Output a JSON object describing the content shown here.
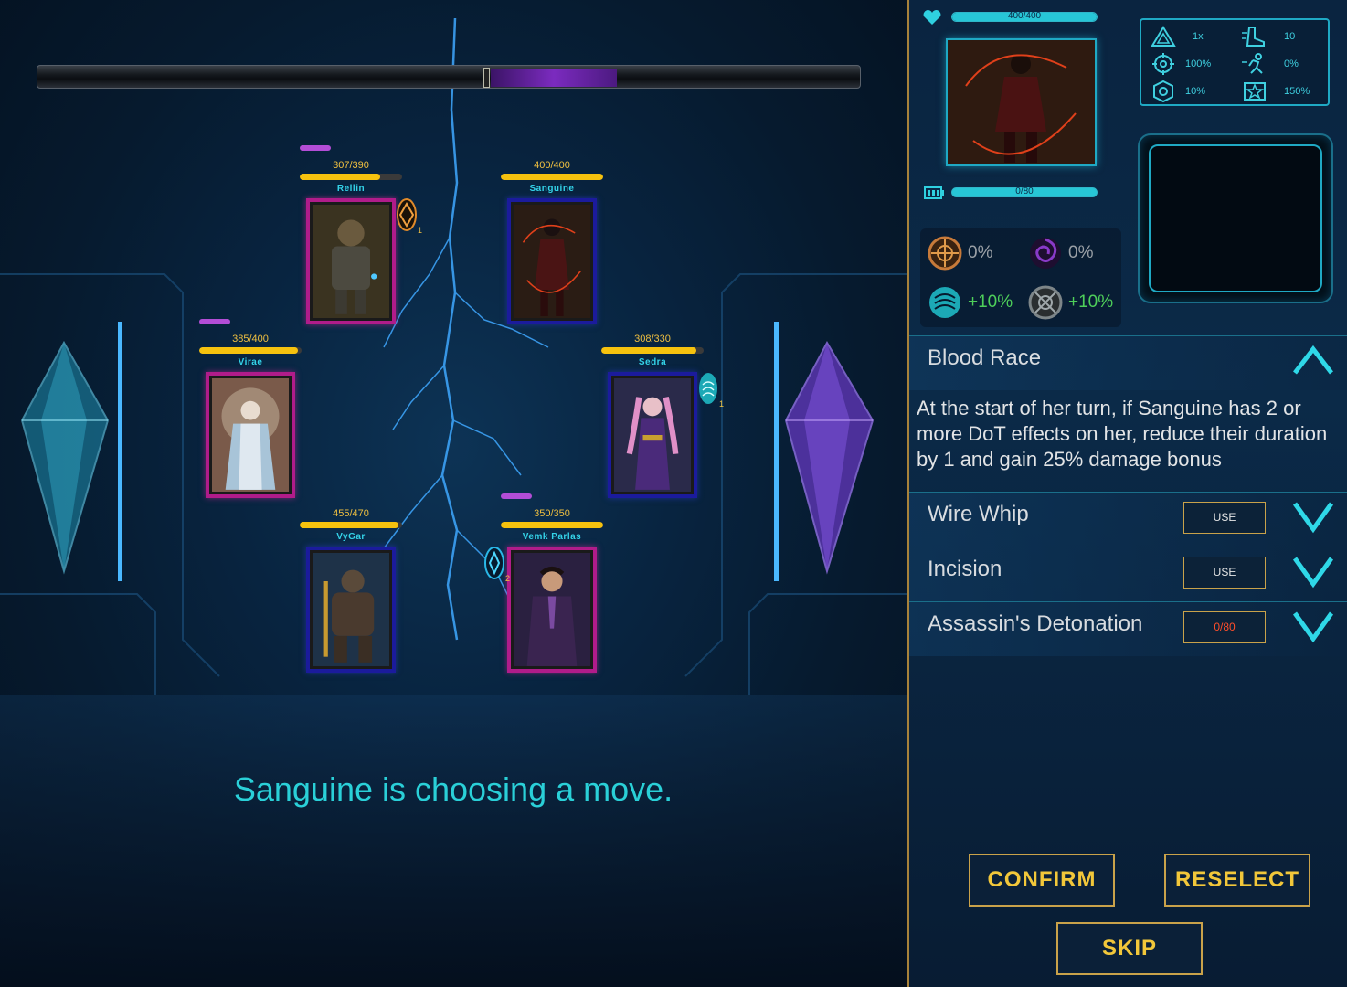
{
  "turn_order": {
    "marker_label": "",
    "active_color": "#7b2bbf"
  },
  "units": [
    {
      "id": "rellin",
      "name": "Rellin",
      "hp_text": "307/390",
      "hp_fraction": 0.787,
      "side": "ally",
      "has_status_pill": true,
      "buff": {
        "icon": "shield-rune-orange-icon",
        "count": "1"
      }
    },
    {
      "id": "sanguine",
      "name": "Sanguine",
      "hp_text": "400/400",
      "hp_fraction": 1.0,
      "side": "enemy",
      "has_status_pill": false
    },
    {
      "id": "virae",
      "name": "Virae",
      "hp_text": "385/400",
      "hp_fraction": 0.9625,
      "side": "ally",
      "has_status_pill": true
    },
    {
      "id": "sedra",
      "name": "Sedra",
      "hp_text": "308/330",
      "hp_fraction": 0.933,
      "side": "enemy",
      "has_status_pill": false,
      "buff": {
        "icon": "water-swirl-icon",
        "count": "1"
      }
    },
    {
      "id": "vygar",
      "name": "VyGar",
      "hp_text": "455/470",
      "hp_fraction": 0.968,
      "side": "enemy",
      "has_status_pill": false
    },
    {
      "id": "vemk",
      "name": "Vemk Parlas",
      "hp_text": "350/350",
      "hp_fraction": 1.0,
      "side": "ally",
      "has_status_pill": true,
      "buff": {
        "icon": "diamond-rune-blue-icon",
        "count": "2"
      }
    }
  ],
  "prompt": "Sanguine is choosing a move.",
  "panel": {
    "health": {
      "text": "400/400",
      "fraction": 1.0,
      "icon": "heart-icon"
    },
    "energy": {
      "text": "0/80",
      "fraction": 0.0,
      "icon": "battery-icon"
    },
    "stats": [
      {
        "icon": "triangle-alert-icon",
        "value": "1x"
      },
      {
        "icon": "boot-speed-icon",
        "value": "10"
      },
      {
        "icon": "crosshair-icon",
        "value": "100%"
      },
      {
        "icon": "dodge-runner-icon",
        "value": "0%"
      },
      {
        "icon": "gear-target-icon",
        "value": "10%"
      },
      {
        "icon": "crit-burst-icon",
        "value": "150%"
      }
    ],
    "resistances": [
      {
        "icon": "fire-rune-icon",
        "value": "0%",
        "color": "#c77a3a",
        "text_color": "#9aa0a6"
      },
      {
        "icon": "void-swirl-icon",
        "value": "0%",
        "color": "#6b2f9a",
        "text_color": "#9aa0a6"
      },
      {
        "icon": "water-swirl-icon",
        "value": "+10%",
        "color": "#1ca9b6",
        "text_color": "#4ecf5a"
      },
      {
        "icon": "metal-gear-icon",
        "value": "+10%",
        "color": "#7d8588",
        "text_color": "#4ecf5a"
      }
    ],
    "passive": {
      "name": "Blood Race",
      "description": "At the start of her turn, if Sanguine has 2 or more DoT effects on her, reduce their duration by 1 and gain 25% damage bonus"
    },
    "skills": [
      {
        "name": "Wire Whip",
        "button": "USE",
        "is_cost": false
      },
      {
        "name": "Incision",
        "button": "USE",
        "is_cost": false
      },
      {
        "name": "Assassin's Detonation",
        "button": "0/80",
        "is_cost": true
      }
    ],
    "buttons": {
      "confirm": "CONFIRM",
      "reselect": "RESELECT",
      "skip": "SKIP"
    }
  }
}
